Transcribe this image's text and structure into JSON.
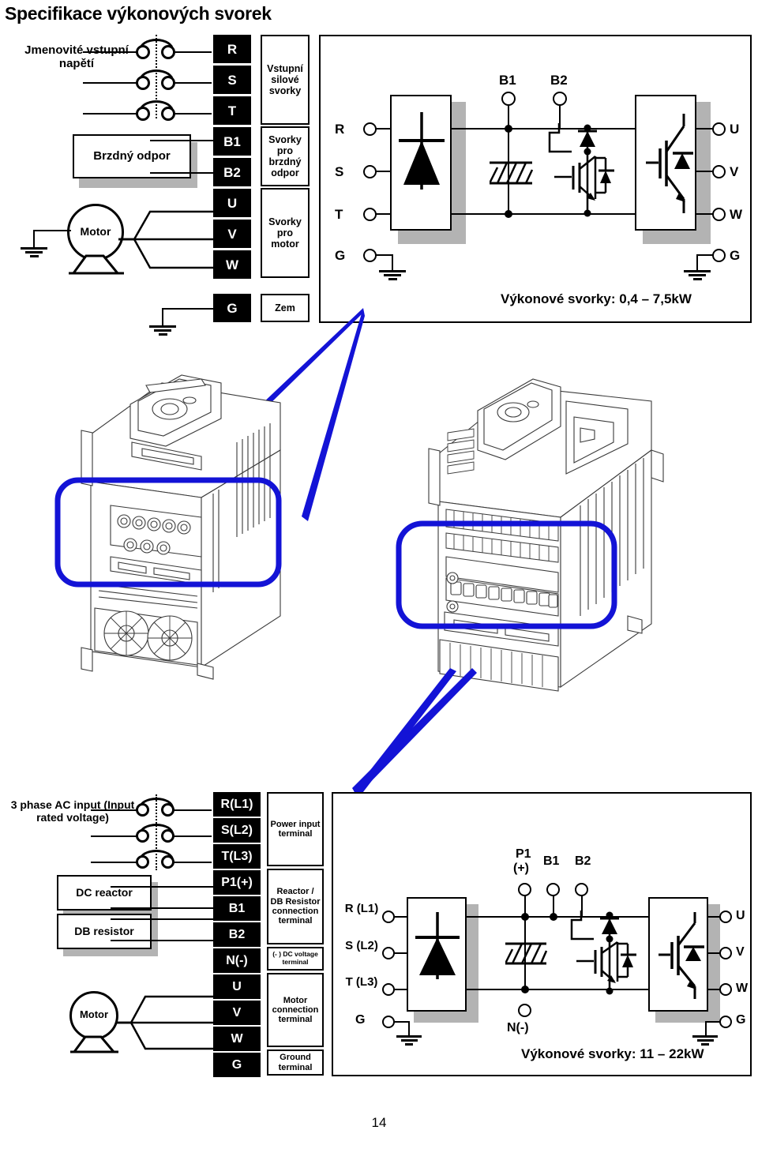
{
  "page": {
    "title": "Specifikace výkonových svorek",
    "number": "14"
  },
  "top_section": {
    "source_label": "Jmenovité vstupní napětí",
    "brake_resistor_label": "Brzdný odpor",
    "motor_label": "Motor",
    "terminals": [
      {
        "name": "R"
      },
      {
        "name": "S"
      },
      {
        "name": "T"
      },
      {
        "name": "B1"
      },
      {
        "name": "B2"
      },
      {
        "name": "U"
      },
      {
        "name": "V"
      },
      {
        "name": "W"
      },
      {
        "name": "G"
      }
    ],
    "groups": [
      {
        "label": "Vstupní silové svorky"
      },
      {
        "label": "Svorky pro brzdný odpor"
      },
      {
        "label": "Svorky pro motor"
      },
      {
        "label": "Zem"
      }
    ],
    "schematic": {
      "inputs": [
        "R",
        "S",
        "T"
      ],
      "ground_in": "G",
      "dc_bus": [
        "B1",
        "B2"
      ],
      "outputs": [
        "U",
        "V",
        "W"
      ],
      "ground_out": "G",
      "caption": "Výkonové svorky: 0,4 – 7,5kW"
    }
  },
  "bottom_section": {
    "source_label": "3 phase AC input (Input rated voltage)",
    "dc_reactor_label": "DC reactor",
    "db_resistor_label": "DB resistor",
    "motor_label": "Motor",
    "terminals": [
      {
        "name": "R(L1)"
      },
      {
        "name": "S(L2)"
      },
      {
        "name": "T(L3)"
      },
      {
        "name": "P1(+)"
      },
      {
        "name": "B1"
      },
      {
        "name": "B2"
      },
      {
        "name": "N(-)"
      },
      {
        "name": "U"
      },
      {
        "name": "V"
      },
      {
        "name": "W"
      },
      {
        "name": "G"
      }
    ],
    "groups": [
      {
        "label": "Power input terminal"
      },
      {
        "label": "Reactor / DB Resistor connection terminal"
      },
      {
        "label": "(- ) DC voltage terminal"
      },
      {
        "label": "Motor connection terminal"
      },
      {
        "label": "Ground terminal"
      }
    ],
    "schematic": {
      "input_r": "R (L1)",
      "input_s": "S (L2)",
      "input_t": "T (L3)",
      "ground_in": "G",
      "bus_p1_a": "P1",
      "bus_p1_b": "(+)",
      "bus_b1": "B1",
      "bus_b2": "B2",
      "bus_n": "N(-)",
      "output_u": "U",
      "output_v": "V",
      "output_w": "W",
      "ground_out": "G",
      "caption": "Výkonové svorky: 11 – 22kW"
    }
  },
  "colors": {
    "annotation": "#1313d6",
    "terminal_pad": "#000000",
    "shadow": "#b3b3b3"
  }
}
